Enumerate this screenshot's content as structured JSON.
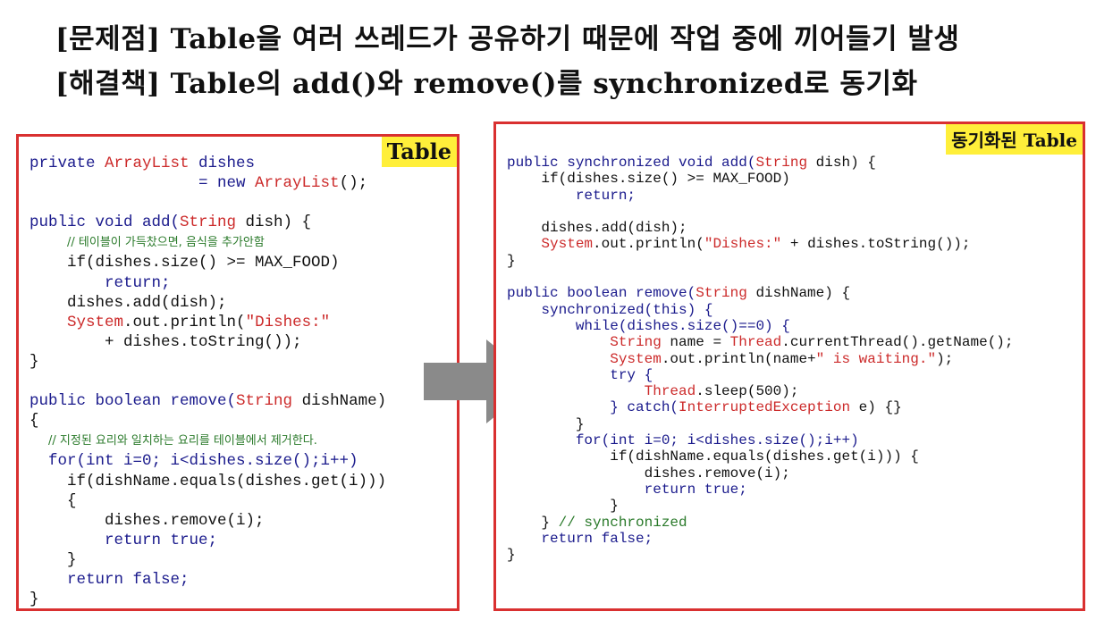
{
  "headline": {
    "problem": "[문제점] Table을 여러 쓰레드가 공유하기 때문에 작업 중에 끼어들기 발생",
    "solution": "[해결책] Table의 add()와 remove()를 synchronized로 동기화"
  },
  "left_panel": {
    "badge": "Table",
    "lines": [
      [
        {
          "t": "private ",
          "c": "k"
        },
        {
          "t": "ArrayList",
          "c": "r"
        },
        {
          "t": " dishes",
          "c": "k"
        }
      ],
      [
        {
          "t": "                  = new ",
          "c": "k"
        },
        {
          "t": "ArrayList",
          "c": "r"
        },
        {
          "t": "();",
          "c": "p"
        }
      ],
      [],
      [
        {
          "t": "public void add(",
          "c": "k"
        },
        {
          "t": "String",
          "c": "r"
        },
        {
          "t": " dish) {",
          "c": "p"
        }
      ],
      [
        {
          "t": "    ",
          "c": "p"
        },
        {
          "t": "// 테이블이 가득찼으면, 음식을 추가안함",
          "c": "c"
        }
      ],
      [
        {
          "t": "    if(dishes.size() >= MAX_FOOD)",
          "c": "p"
        }
      ],
      [
        {
          "t": "        return;",
          "c": "k"
        }
      ],
      [
        {
          "t": "    dishes.add(dish);",
          "c": "p"
        }
      ],
      [
        {
          "t": "    ",
          "c": "p"
        },
        {
          "t": "System",
          "c": "r"
        },
        {
          "t": ".out.println(",
          "c": "p"
        },
        {
          "t": "\"Dishes:\"",
          "c": "s"
        }
      ],
      [
        {
          "t": "        + dishes.toString());",
          "c": "p"
        }
      ],
      [
        {
          "t": "}",
          "c": "p"
        }
      ],
      [],
      [
        {
          "t": "public boolean remove(",
          "c": "k"
        },
        {
          "t": "String",
          "c": "r"
        },
        {
          "t": " dishName)",
          "c": "p"
        }
      ],
      [
        {
          "t": "{",
          "c": "p"
        }
      ],
      [
        {
          "t": "  ",
          "c": "p"
        },
        {
          "t": "// 지정된 요리와 일치하는 요리를 테이블에서 제거한다.",
          "c": "c"
        }
      ],
      [
        {
          "t": "  for(int i=0; i<dishes.size();i++)",
          "c": "k"
        }
      ],
      [
        {
          "t": "    if(dishName.equals(dishes.get(i)))",
          "c": "p"
        }
      ],
      [
        {
          "t": "    {",
          "c": "p"
        }
      ],
      [
        {
          "t": "        dishes.remove(i);",
          "c": "p"
        }
      ],
      [
        {
          "t": "        return true;",
          "c": "k"
        }
      ],
      [
        {
          "t": "    }",
          "c": "p"
        }
      ],
      [
        {
          "t": "    return false;",
          "c": "k"
        }
      ],
      [
        {
          "t": "}",
          "c": "p"
        }
      ]
    ]
  },
  "right_panel": {
    "badge": "동기화된 Table",
    "lines": [
      [
        {
          "t": "public synchronized void add(",
          "c": "k"
        },
        {
          "t": "String",
          "c": "r"
        },
        {
          "t": " dish) {",
          "c": "p"
        }
      ],
      [
        {
          "t": "    if(dishes.size() >= MAX_FOOD)",
          "c": "p"
        }
      ],
      [
        {
          "t": "        return;",
          "c": "k"
        }
      ],
      [],
      [
        {
          "t": "    dishes.add(dish);",
          "c": "p"
        }
      ],
      [
        {
          "t": "    ",
          "c": "p"
        },
        {
          "t": "System",
          "c": "r"
        },
        {
          "t": ".out.println(",
          "c": "p"
        },
        {
          "t": "\"Dishes:\"",
          "c": "s"
        },
        {
          "t": " + dishes.toString());",
          "c": "p"
        }
      ],
      [
        {
          "t": "}",
          "c": "p"
        }
      ],
      [],
      [
        {
          "t": "public boolean remove(",
          "c": "k"
        },
        {
          "t": "String",
          "c": "r"
        },
        {
          "t": " dishName) {",
          "c": "p"
        }
      ],
      [
        {
          "t": "    synchronized(this) {",
          "c": "k"
        }
      ],
      [
        {
          "t": "        while(dishes.size()==0) {",
          "c": "k"
        }
      ],
      [
        {
          "t": "            ",
          "c": "p"
        },
        {
          "t": "String",
          "c": "r"
        },
        {
          "t": " name = ",
          "c": "p"
        },
        {
          "t": "Thread",
          "c": "r"
        },
        {
          "t": ".currentThread().getName();",
          "c": "p"
        }
      ],
      [
        {
          "t": "            ",
          "c": "p"
        },
        {
          "t": "System",
          "c": "r"
        },
        {
          "t": ".out.println(name+",
          "c": "p"
        },
        {
          "t": "\" is waiting.\"",
          "c": "s"
        },
        {
          "t": ");",
          "c": "p"
        }
      ],
      [
        {
          "t": "            try {",
          "c": "k"
        }
      ],
      [
        {
          "t": "                ",
          "c": "p"
        },
        {
          "t": "Thread",
          "c": "r"
        },
        {
          "t": ".sleep(500);",
          "c": "p"
        }
      ],
      [
        {
          "t": "            } catch(",
          "c": "k"
        },
        {
          "t": "InterruptedException",
          "c": "r"
        },
        {
          "t": " e) {}",
          "c": "p"
        }
      ],
      [
        {
          "t": "        }",
          "c": "p"
        }
      ],
      [
        {
          "t": "        for(int i=0; i<dishes.size();i++)",
          "c": "k"
        }
      ],
      [
        {
          "t": "            if(dishName.equals(dishes.get(i))) {",
          "c": "p"
        }
      ],
      [
        {
          "t": "                dishes.remove(i);",
          "c": "p"
        }
      ],
      [
        {
          "t": "                return true;",
          "c": "k"
        }
      ],
      [
        {
          "t": "            }",
          "c": "p"
        }
      ],
      [
        {
          "t": "    } ",
          "c": "p"
        },
        {
          "t": "// synchronized",
          "c": "cm"
        }
      ],
      [
        {
          "t": "    return false;",
          "c": "k"
        }
      ],
      [
        {
          "t": "}",
          "c": "p"
        }
      ]
    ]
  },
  "colors": {
    "panel_border": "#d93030",
    "badge_bg": "#ffef3a",
    "arrow": "#8a8a8a"
  }
}
